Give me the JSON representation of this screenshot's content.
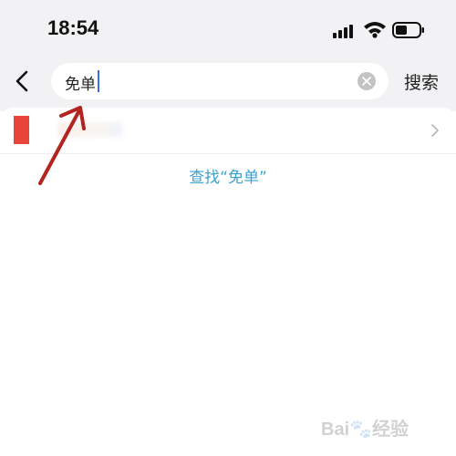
{
  "status_bar": {
    "time": "18:54"
  },
  "search": {
    "query": "免单",
    "submit_label": "搜索"
  },
  "result": {
    "chevron": "›"
  },
  "find_label": "查找“免单”",
  "watermark": {
    "text": "Bai",
    "suffix": "经验"
  },
  "colors": {
    "accent_link": "#3aa3d0",
    "thumb_red": "#e8443a",
    "annotation_arrow": "#b3231f",
    "top_bg": "#f2f2f4"
  },
  "icons": [
    "back-arrow-icon",
    "signal-icon",
    "wifi-icon",
    "battery-icon",
    "clear-icon",
    "chevron-right-icon"
  ]
}
